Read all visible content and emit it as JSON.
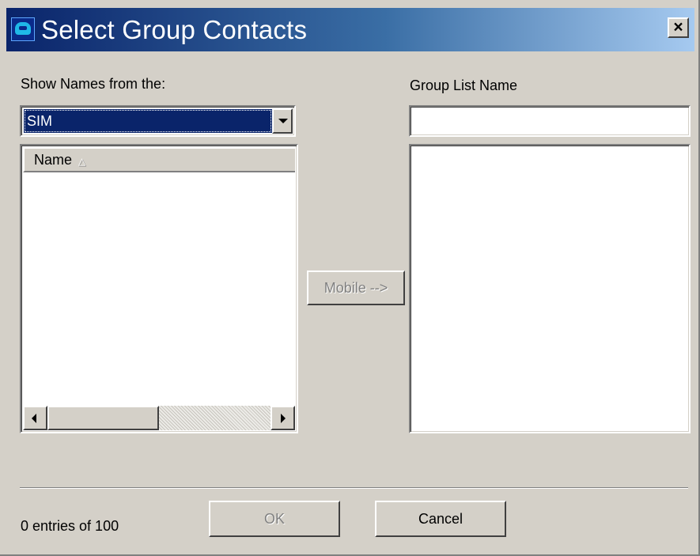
{
  "window": {
    "title": "Select Group Contacts",
    "close_label": "×",
    "icon": "app-icon"
  },
  "left": {
    "source_label": "Show Names from the:",
    "source_selected": "SIM",
    "list_header": "Name",
    "sort_indicator": "△"
  },
  "right": {
    "group_name_label": "Group List Name",
    "group_name_value": ""
  },
  "buttons": {
    "mobile_label": "Mobile -->",
    "ok_label": "OK",
    "cancel_label": "Cancel"
  },
  "status": {
    "entries_text": "0 entries of 100"
  },
  "colors": {
    "dialog_bg": "#d4d0c8",
    "title_gradient_start": "#0a246a",
    "title_gradient_end": "#a6caf0",
    "selection_bg": "#0a246a"
  }
}
